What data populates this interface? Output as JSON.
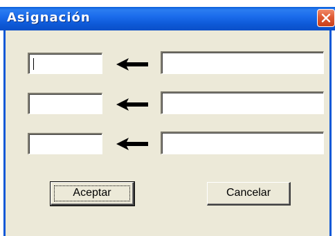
{
  "window": {
    "title": "Asignación",
    "close_icon": "close-icon",
    "accent_color": "#0d58d6",
    "close_color": "#e05a32"
  },
  "form": {
    "rows": [
      {
        "left_value": "",
        "right_value": "",
        "arrow_icon": "arrow-left-icon"
      },
      {
        "left_value": "",
        "right_value": "",
        "arrow_icon": "arrow-left-icon"
      },
      {
        "left_value": "",
        "right_value": "",
        "arrow_icon": "arrow-left-icon"
      }
    ]
  },
  "buttons": {
    "accept_label": "Aceptar",
    "cancel_label": "Cancelar"
  }
}
